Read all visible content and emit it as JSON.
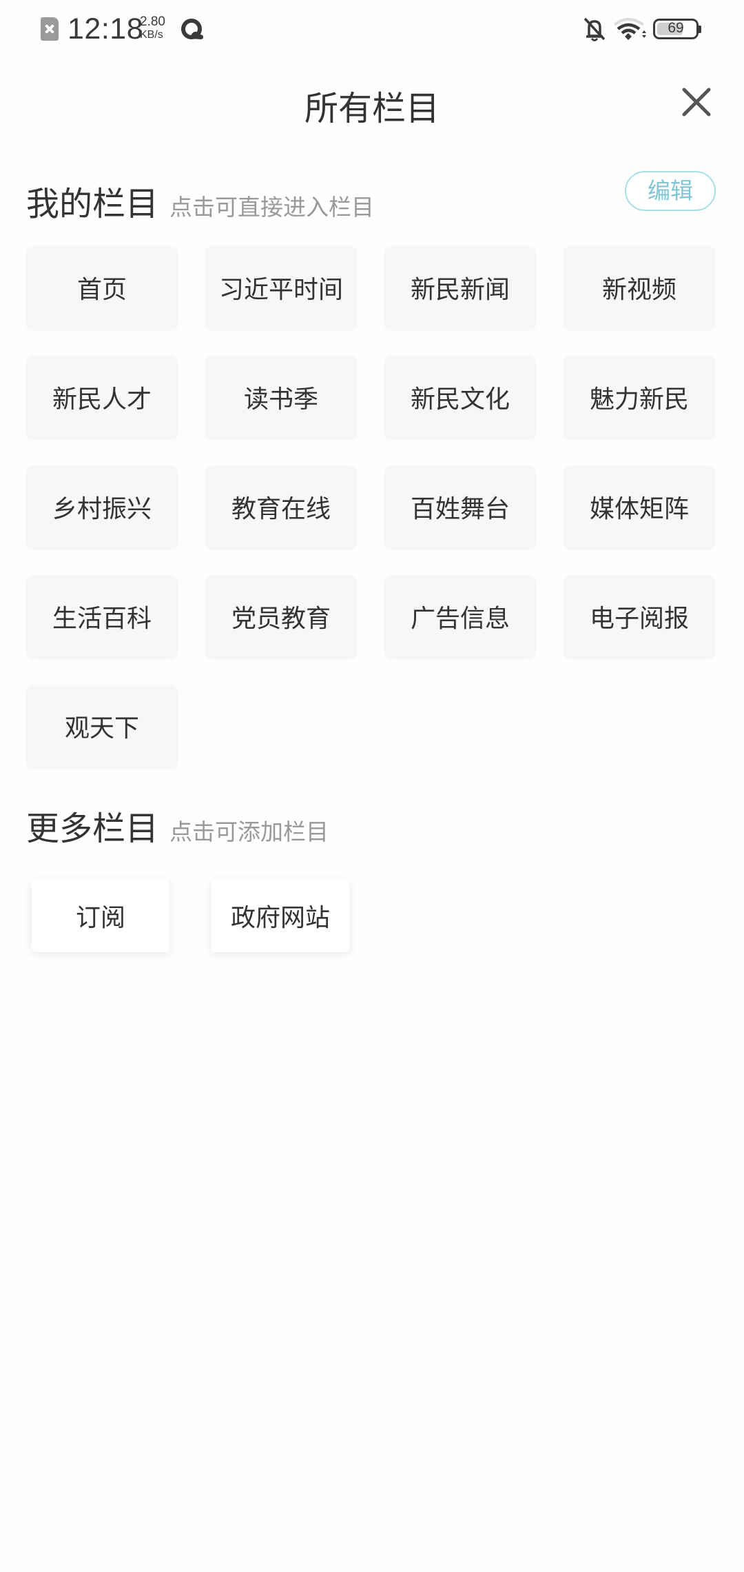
{
  "status_bar": {
    "time": "12:18",
    "net_speed_value": "2.80",
    "net_speed_unit": "KB/s",
    "battery_level": "69",
    "battery_fraction": 0.69,
    "icons": [
      "sim-absent-icon",
      "app-notification-icon",
      "bell-muted-icon",
      "wifi-icon",
      "battery-icon"
    ]
  },
  "header": {
    "title": "所有栏目",
    "close_icon": "close-icon"
  },
  "my_columns": {
    "title": "我的栏目",
    "subtitle": "点击可直接进入栏目",
    "edit_label": "编辑",
    "accent_color": "#7fc7d6",
    "items": [
      "首页",
      "习近平时间",
      "新民新闻",
      "新视频",
      "新民人才",
      "读书季",
      "新民文化",
      "魅力新民",
      "乡村振兴",
      "教育在线",
      "百姓舞台",
      "媒体矩阵",
      "生活百科",
      "党员教育",
      "广告信息",
      "电子阅报",
      "观天下"
    ]
  },
  "more_columns": {
    "title": "更多栏目",
    "subtitle": "点击可添加栏目",
    "items": [
      "订阅",
      "政府网站"
    ]
  }
}
